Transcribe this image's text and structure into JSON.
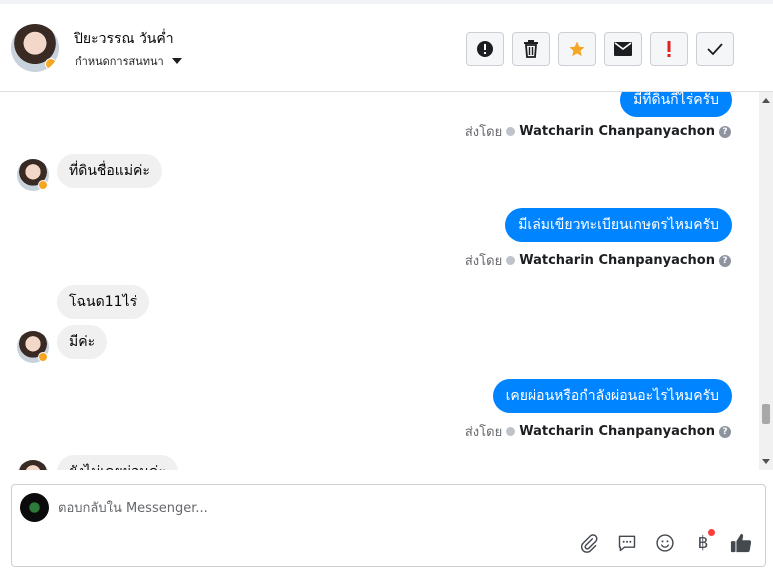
{
  "colors": {
    "accent": "#0084ff",
    "star": "#f5a623",
    "alert": "#e02020",
    "incoming_bubble": "#f0f0f0"
  },
  "header": {
    "name": "ปิยะวรรณ วันค่ำ",
    "assign_label": "กำหนดการสนทนา",
    "actions": [
      "info-icon",
      "trash-icon",
      "star-icon",
      "envelope-icon",
      "exclamation-icon",
      "check-icon"
    ]
  },
  "messages": [
    {
      "direction": "out",
      "text": "มีที่ดินกี่ไร่ครับ"
    },
    {
      "direction": "in",
      "text": "ที่ดินชื่อแม่ค่ะ"
    },
    {
      "direction": "out",
      "text": "มีเล่มเขียวทะเบียนเกษตรไหมครับ"
    },
    {
      "direction": "in",
      "text": "โฉนด11ไร่"
    },
    {
      "direction": "in",
      "text": "มีค่ะ"
    },
    {
      "direction": "out",
      "text": "เคยผ่อนหรือกำลังผ่อนอะไรไหมครับ"
    },
    {
      "direction": "in",
      "text": "ยังไม่เคยผ่อนค่ะ"
    }
  ],
  "sent_by": {
    "label": "ส่งโดย",
    "name": "Watcharin Chanpanyachon",
    "help": "?"
  },
  "composer": {
    "placeholder": "ตอบกลับใน Messenger...",
    "tools": [
      "paperclip-icon",
      "saved-reply-icon",
      "emoji-icon",
      "baht-payment-icon",
      "thumbs-up-icon"
    ],
    "baht_symbol": "฿"
  }
}
